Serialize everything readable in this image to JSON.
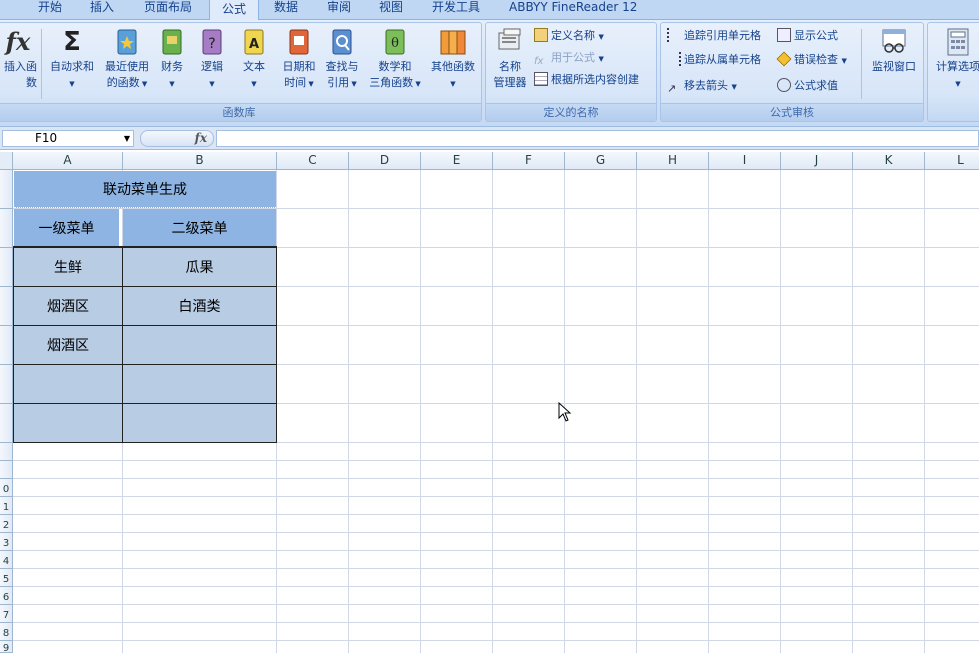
{
  "tabs": [
    "开始",
    "插入",
    "页面布局",
    "公式",
    "数据",
    "审阅",
    "视图",
    "开发工具",
    "ABBYY FineReader 12"
  ],
  "active_tab": "公式",
  "ribbon": {
    "function_library": {
      "group_label": "函数库",
      "buttons": {
        "insert_function": "插入函数",
        "autosum_line1": "自动求和",
        "recent_line1": "最近使用",
        "recent_line2": "的函数",
        "financial": "财务",
        "logical": "逻辑",
        "text": "文本",
        "datetime_line1": "日期和",
        "datetime_line2": "时间",
        "lookup_line1": "查找与",
        "lookup_line2": "引用",
        "math_line1": "数学和",
        "math_line2": "三角函数",
        "other": "其他函数"
      }
    },
    "defined_names": {
      "group_label": "定义的名称",
      "name_manager_line1": "名称",
      "name_manager_line2": "管理器",
      "define_name": "定义名称",
      "use_in_formula": "用于公式",
      "create_from_selection": "根据所选内容创建"
    },
    "formula_auditing": {
      "group_label": "公式审核",
      "trace_precedents": "追踪引用单元格",
      "trace_dependents": "追踪从属单元格",
      "remove_arrows": "移去箭头",
      "show_formulas": "显示公式",
      "error_checking": "错误检查",
      "evaluate_formula": "公式求值",
      "watch_window": "监视窗口"
    },
    "calculation": {
      "options": "计算选项"
    }
  },
  "formula_bar": {
    "name_box": "F10",
    "fx_label": "fx",
    "formula": ""
  },
  "columns": [
    "A",
    "B",
    "C",
    "D",
    "E",
    "F",
    "G",
    "H",
    "I",
    "J",
    "K",
    "L"
  ],
  "row_numbers": [
    "",
    "",
    "",
    "",
    "",
    "",
    "",
    "",
    "",
    "0",
    "1",
    "2",
    "3",
    "4",
    "5",
    "6",
    "7",
    "8",
    "9"
  ],
  "sheet": {
    "title": "联动菜单生成",
    "header_a": "一级菜单",
    "header_b": "二级菜单",
    "rows": [
      {
        "a": "生鲜",
        "b": "瓜果"
      },
      {
        "a": "烟酒区",
        "b": "白酒类"
      },
      {
        "a": "烟酒区",
        "b": ""
      },
      {
        "a": "",
        "b": ""
      },
      {
        "a": "",
        "b": ""
      }
    ]
  },
  "colors": {
    "header_fill": "#8db4e2",
    "data_fill": "#b8cce4",
    "ribbon_bg": "#d6e5f8"
  }
}
